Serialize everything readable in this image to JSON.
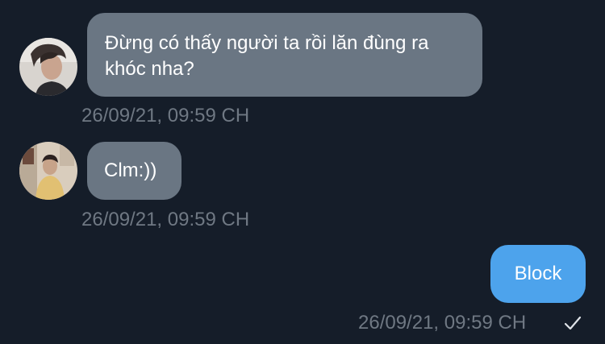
{
  "conversation": {
    "messages": [
      {
        "direction": "incoming",
        "text": "Đừng có thấy người ta rồi lăn đùng ra khóc nha?",
        "timestamp": "26/09/21, 09:59 CH"
      },
      {
        "direction": "incoming",
        "text": "Clm:))",
        "timestamp": "26/09/21, 09:59 CH"
      },
      {
        "direction": "outgoing",
        "text": "Block",
        "timestamp": "26/09/21, 09:59 CH",
        "status_icon": "checkmark-icon"
      }
    ]
  },
  "colors": {
    "background": "#151d29",
    "incoming_bubble": "#6a7683",
    "outgoing_bubble": "#4da3ec",
    "timestamp_text": "#6f7883"
  }
}
